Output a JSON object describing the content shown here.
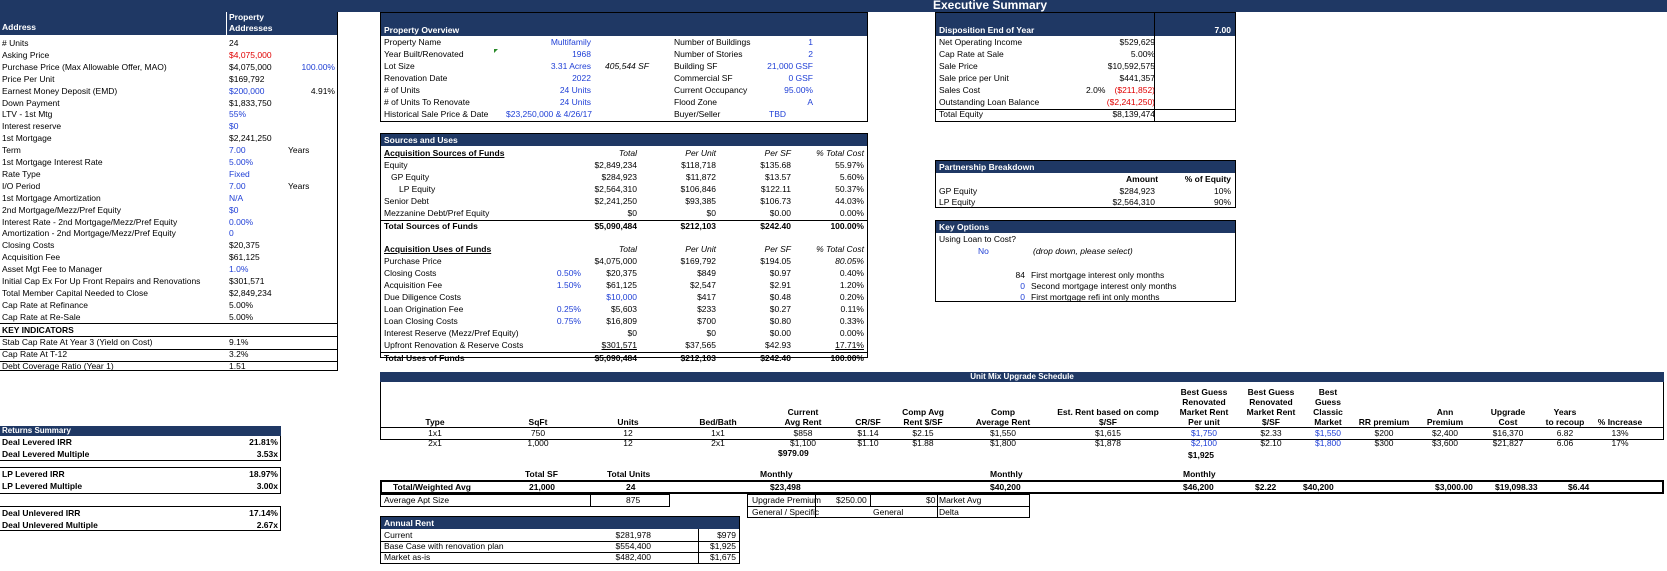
{
  "title": "Executive Summary",
  "address_panel": {
    "header_label": "Address",
    "header_value": "Property\nAddresses",
    "rows": [
      {
        "label": "# Units",
        "value": "24",
        "vcls": "",
        "extra": "",
        "ecls": ""
      },
      {
        "label": "Asking Price",
        "value": "$4,075,000",
        "vcls": "red",
        "extra": "",
        "ecls": ""
      },
      {
        "label": "Purchase Price (Max Allowable Offer, MAO)",
        "value": "$4,075,000",
        "vcls": "",
        "extra": "100.00%",
        "ecls": "blue r"
      },
      {
        "label": "Price Per Unit",
        "value": "$169,792",
        "vcls": "",
        "extra": "",
        "ecls": ""
      },
      {
        "label": "Earnest Money Deposit (EMD)",
        "value": "$200,000",
        "vcls": "blue",
        "extra": "4.91%",
        "ecls": "r"
      },
      {
        "label": "Down Payment",
        "value": "$1,833,750",
        "vcls": "",
        "extra": "",
        "ecls": ""
      },
      {
        "label": "LTV - 1st Mtg",
        "value": "55%",
        "vcls": "blue",
        "extra": "",
        "ecls": ""
      },
      {
        "label": "Interest reserve",
        "value": "$0",
        "vcls": "blue",
        "extra": "",
        "ecls": ""
      },
      {
        "label": "1st Mortgage",
        "value": "$2,241,250",
        "vcls": "",
        "extra": "",
        "ecls": ""
      },
      {
        "label": "Term",
        "value": "7.00",
        "vcls": "blue",
        "extra": "Years",
        "ecls": "yrs"
      },
      {
        "label": "1st Mortgage Interest Rate",
        "value": "5.00%",
        "vcls": "blue",
        "extra": "",
        "ecls": ""
      },
      {
        "label": "Rate Type",
        "value": "Fixed",
        "vcls": "blue",
        "extra": "",
        "ecls": ""
      },
      {
        "label": "I/O Period",
        "value": "7.00",
        "vcls": "blue",
        "extra": "Years",
        "ecls": "yrs"
      },
      {
        "label": "1st Mortgage Amortization",
        "value": "N/A",
        "vcls": "blue",
        "extra": "",
        "ecls": ""
      },
      {
        "label": "2nd Mortgage/Mezz/Pref Equity",
        "value": "$0",
        "vcls": "blue",
        "extra": "",
        "ecls": ""
      },
      {
        "label": "Interest Rate - 2nd Mortgage/Mezz/Pref Equity",
        "value": "0.00%",
        "vcls": "blue",
        "extra": "",
        "ecls": ""
      },
      {
        "label": "Amortization - 2nd Mortgage/Mezz/Pref Equity",
        "value": "0",
        "vcls": "blue",
        "extra": "",
        "ecls": ""
      },
      {
        "label": "Closing Costs",
        "value": "$20,375",
        "vcls": "",
        "extra": "",
        "ecls": ""
      },
      {
        "label": "Acquisition Fee",
        "value": "$61,125",
        "vcls": "",
        "extra": "",
        "ecls": ""
      },
      {
        "label": "Asset Mgt Fee to Manager",
        "value": "1.0%",
        "vcls": "blue",
        "extra": "",
        "ecls": ""
      },
      {
        "label": "Initial Cap Ex For Up Front Repairs and Renovations",
        "value": "$301,571",
        "vcls": "",
        "extra": "",
        "ecls": ""
      },
      {
        "label": "Total Member Capital Needed to Close",
        "value": "$2,849,234",
        "vcls": "",
        "extra": "",
        "ecls": ""
      },
      {
        "label": "Cap Rate at Refinance",
        "value": "5.00%",
        "vcls": "",
        "extra": "",
        "ecls": ""
      },
      {
        "label": "Cap Rate at Re-Sale",
        "value": "5.00%",
        "vcls": "",
        "extra": "",
        "ecls": ""
      }
    ],
    "key_indicators_label": "KEY INDICATORS",
    "indicators": [
      {
        "label": "Stab Cap Rate At Year 3 (Yield on Cost)",
        "value": "9.1%"
      },
      {
        "label": "Cap Rate At T-12",
        "value": "3.2%"
      },
      {
        "label": "Debt Coverage Ratio (Year 1)",
        "value": "1.51"
      }
    ]
  },
  "returns": {
    "header": "Returns Summary",
    "group1": [
      {
        "label": "Deal Levered IRR",
        "value": "21.81%"
      },
      {
        "label": "Deal Levered Multiple",
        "value": "3.53x"
      }
    ],
    "group2": [
      {
        "label": "LP Levered IRR",
        "value": "18.97%"
      },
      {
        "label": "LP Levered Multiple",
        "value": "3.00x"
      }
    ],
    "group3": [
      {
        "label": "Deal Unlevered IRR",
        "value": "17.14%"
      },
      {
        "label": "Deal Unlevered Multiple",
        "value": "2.67x"
      }
    ]
  },
  "overview": {
    "header": "Property Overview",
    "left": [
      {
        "label": "Property Name",
        "value": "Multifamily",
        "extra": ""
      },
      {
        "label": "Year Built/Renovated",
        "value": "1968",
        "extra": ""
      },
      {
        "label": "Lot Size",
        "value": "3.31 Acres",
        "extra": "405,544 SF"
      },
      {
        "label": "Renovation Date",
        "value": "2022",
        "extra": ""
      },
      {
        "label": "# of Units",
        "value": "24 Units",
        "extra": ""
      },
      {
        "label": "# of Units To Renovate",
        "value": "24 Units",
        "extra": ""
      },
      {
        "label": "Historical Sale Price & Date",
        "value": "$23,250,000 & 4/26/17",
        "extra": ""
      }
    ],
    "right": [
      {
        "label": "Number of Buildings",
        "value": "1"
      },
      {
        "label": "Number of Stories",
        "value": "2"
      },
      {
        "label": "Building SF",
        "value": "21,000 GSF"
      },
      {
        "label": "Commercial SF",
        "value": "0 GSF"
      },
      {
        "label": "Current Occupancy",
        "value": "95.00%"
      },
      {
        "label": "Flood Zone",
        "value": "A"
      },
      {
        "label": "Buyer/Seller",
        "value": "TBD"
      }
    ]
  },
  "sources_uses": {
    "header": "Sources and Uses",
    "cols": [
      "Total",
      "Per Unit",
      "Per SF",
      "% Total Cost"
    ],
    "sources_title": "Acquisition Sources of Funds",
    "sources": [
      {
        "label": "Equity",
        "pct": "",
        "t": "$2,849,234",
        "pu": "$118,718",
        "ps": "$135.68",
        "pc": "55.97%"
      },
      {
        "label": "GP Equity",
        "pct": "",
        "t": "$284,923",
        "pu": "$11,872",
        "ps": "$13.57",
        "pc": "5.60%"
      },
      {
        "label": "LP Equity",
        "pct": "",
        "t": "$2,564,310",
        "pu": "$106,846",
        "ps": "$122.11",
        "pc": "50.37%"
      },
      {
        "label": "Senior Debt",
        "pct": "",
        "t": "$2,241,250",
        "pu": "$93,385",
        "ps": "$106.73",
        "pc": "44.03%"
      },
      {
        "label": "Mezzanine Debt/Pref Equity",
        "pct": "",
        "t": "$0",
        "pu": "$0",
        "ps": "$0.00",
        "pc": "0.00%"
      }
    ],
    "sources_total": {
      "label": "Total Sources of Funds",
      "t": "$5,090,484",
      "pu": "$212,103",
      "ps": "$242.40",
      "pc": "100.00%"
    },
    "uses_title": "Acquisition Uses of Funds",
    "uses": [
      {
        "label": "Purchase Price",
        "pct": "",
        "t": "$4,075,000",
        "pu": "$169,792",
        "ps": "$194.05",
        "pc": "80.05%"
      },
      {
        "label": "Closing Costs",
        "pct": "0.50%",
        "t": "$20,375",
        "pu": "$849",
        "ps": "$0.97",
        "pc": "0.40%"
      },
      {
        "label": "Acquisition Fee",
        "pct": "1.50%",
        "t": "$61,125",
        "pu": "$2,547",
        "ps": "$2.91",
        "pc": "1.20%"
      },
      {
        "label": "Due Diligence Costs",
        "pct": "",
        "t": "$10,000",
        "pu": "$417",
        "ps": "$0.48",
        "pc": "0.20%"
      },
      {
        "label": "Loan Origination Fee",
        "pct": "0.25%",
        "t": "$5,603",
        "pu": "$233",
        "ps": "$0.27",
        "pc": "0.11%"
      },
      {
        "label": "Loan Closing Costs",
        "pct": "0.75%",
        "t": "$16,809",
        "pu": "$700",
        "ps": "$0.80",
        "pc": "0.33%"
      },
      {
        "label": "Interest Reserve (Mezz/Pref Equity)",
        "pct": "",
        "t": "$0",
        "pu": "$0",
        "ps": "$0.00",
        "pc": "0.00%"
      },
      {
        "label": "Upfront Renovation & Reserve Costs",
        "pct": "",
        "t": "$301,571",
        "pu": "$37,565",
        "ps": "$42.93",
        "pc": "17.71%"
      }
    ],
    "uses_total": {
      "label": "Total Uses of Funds",
      "t": "$5,090,484",
      "pu": "$212,103",
      "ps": "$242.40",
      "pc": "100.00%"
    }
  },
  "disposition": {
    "header": "Disposition End of Year",
    "header_value": "7.00",
    "rows": [
      {
        "label": "Net Operating Income",
        "mid": "",
        "value": "$529,629",
        "cls": ""
      },
      {
        "label": "Cap Rate at Sale",
        "mid": "",
        "value": "5.00%",
        "cls": ""
      },
      {
        "label": "Sale Price",
        "mid": "",
        "value": "$10,592,575",
        "cls": ""
      },
      {
        "label": "Sale price per Unit",
        "mid": "",
        "value": "$441,357",
        "cls": ""
      },
      {
        "label": "Sales Cost",
        "mid": "2.0%",
        "value": "($211,852)",
        "cls": "red"
      },
      {
        "label": "Outstanding Loan Balance",
        "mid": "",
        "value": "($2,241,250)",
        "cls": "red"
      },
      {
        "label": "Total Equity",
        "mid": "",
        "value": "$8,139,474",
        "cls": ""
      }
    ]
  },
  "partnership": {
    "header": "Partnership Breakdown",
    "col1": "Amount",
    "col2": "% of Equity",
    "rows": [
      {
        "label": "GP Equity",
        "amount": "$284,923",
        "pct": "10%"
      },
      {
        "label": "LP Equity",
        "amount": "$2,564,310",
        "pct": "90%"
      }
    ]
  },
  "key_options": {
    "header": "Key Options",
    "question": "Using Loan to Cost?",
    "answer": "No",
    "hint": "(drop down, please select)",
    "items": [
      {
        "num": "84",
        "label": "First mortgage interest only months"
      },
      {
        "num": "0",
        "label": "Second mortgage interest only months"
      },
      {
        "num": "0",
        "label": "First mortgage refi int only months"
      }
    ]
  },
  "unit_mix": {
    "header": "Unit Mix Upgrade Schedule",
    "columns": [
      "Type",
      "SqFt",
      "Units",
      "Bed/Bath",
      "Current\nAvg Rent",
      "CR/SF",
      "Comp Avg\nRent $/SF",
      "Comp\nAverage Rent",
      "Est. Rent based on comp\n$/SF",
      "Best Guess\nRenovated\nMarket Rent\nPer unit",
      "Best Guess\nRenovated\nMarket Rent\n$/SF",
      "Best\nGuess\nClassic\nMarket",
      "RR premium",
      "Ann\nPremium",
      "Upgrade\nCost",
      "Years\nto recoup",
      "% Increase"
    ],
    "rows": [
      [
        "1x1",
        "750",
        "12",
        "1x1",
        "$858",
        "$1.14",
        "$2.15",
        "$1,550",
        "$1,615",
        "$1,750",
        "$2.33",
        "$1,550",
        "$200",
        "$2,400",
        "$16,370",
        "6.82",
        "13%"
      ],
      [
        "2x1",
        "1,000",
        "12",
        "2x1",
        "$1,100",
        "$1.10",
        "$1.88",
        "$1,800",
        "$1,878",
        "$2,100",
        "$2.10",
        "$1,800",
        "$300",
        "$3,600",
        "$21,827",
        "6.06",
        "17%"
      ]
    ],
    "current_avg": "$979.09",
    "best_guess_avg": "$1,925",
    "total_sf_label": "Total SF",
    "total_units_label": "Total Units",
    "monthly_label": "Monthly",
    "total_label": "Total/Weighted Avg",
    "total_sf": "21,000",
    "total_units": "24",
    "total_monthly_current": "$23,498",
    "total_monthly_comp": "$40,200",
    "total_monthly_best": "$46,200",
    "total_best_sf": "$2.22",
    "total_classic": "$40,200",
    "total_ann": "$3,000.00",
    "total_upgrade": "$19,098.33",
    "total_years": "$6.44",
    "avg_apt_label": "Average Apt Size",
    "avg_apt_value": "875",
    "upgrade_premium_label": "Upgrade Premium",
    "upgrade_premium_value": "$250.00",
    "general_specific_label": "General / Specific",
    "dollar_zero": "$0",
    "general_label": "General",
    "market_avg_label": "Market Avg",
    "delta_label": "Delta"
  },
  "annual_rent": {
    "header": "Annual Rent",
    "rows": [
      {
        "label": "Current",
        "value": "$281,978",
        "per": "$979"
      },
      {
        "label": "Base Case with renovation plan",
        "value": "$554,400",
        "per": "$1,925"
      },
      {
        "label": "Market as-is",
        "value": "$482,400",
        "per": "$1,675"
      }
    ]
  }
}
